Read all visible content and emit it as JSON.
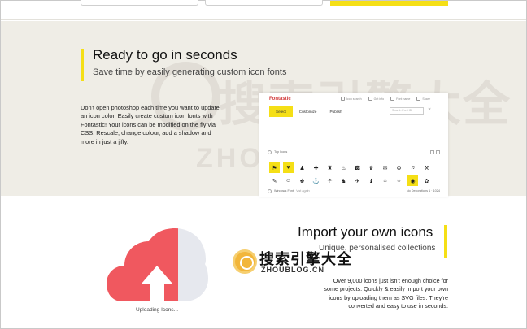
{
  "section1": {
    "title": "Ready to go in seconds",
    "subtitle": "Save time by easily generating custom icon fonts",
    "description": "Don't open photoshop each time you want to update an icon color. Easily create custom icon fonts with Fontastic! Your icons can be modified on the fly via CSS. Rescale, change colour, add a shadow and more in just a jiffy."
  },
  "mockup": {
    "logo": "Fontastic",
    "tools": [
      "Icon search",
      "Get info",
      "Font name",
      "Share"
    ],
    "tabs": [
      {
        "label": "Select",
        "active": true
      },
      {
        "label": "Customize",
        "active": false
      },
      {
        "label": "Publish",
        "active": false
      }
    ],
    "search_placeholder": "Search Font ID",
    "set1_label": "Top Icons",
    "set2_label": "Windows Font",
    "set2_link": "Vist again",
    "set2_right": "No Decorations 1 · 1024",
    "icons_row1": [
      "⚑",
      "♥",
      "♟",
      "✚",
      "♜",
      "♨",
      "☎",
      "♛",
      "✉",
      "⚙",
      "♫",
      "⚒",
      "✂",
      "★"
    ],
    "icons_row2": [
      "✎",
      "☺",
      "♚",
      "⚓",
      "☂",
      "♞",
      "✈",
      "♝",
      "⌂",
      "☼",
      "◉",
      "✿",
      "⚡",
      "☯"
    ]
  },
  "section2": {
    "title": "Import your own icons",
    "subtitle": "Unique, personalised collections",
    "description": "Over 9,000 icons just isn't enough choice for some projects. Quickly & easily import your own icons by uploading them as SVG files. They're converted and easy to use in seconds.",
    "uploading_label": "Uploading Icons..."
  },
  "watermark": {
    "cn": "搜索引擎大全",
    "en": "ZHOUBLOG.CN"
  },
  "colors": {
    "accent": "#f5df16",
    "cloud_red": "#f0585f",
    "cloud_light": "#e6e8ee",
    "section_bg": "#efede6"
  }
}
